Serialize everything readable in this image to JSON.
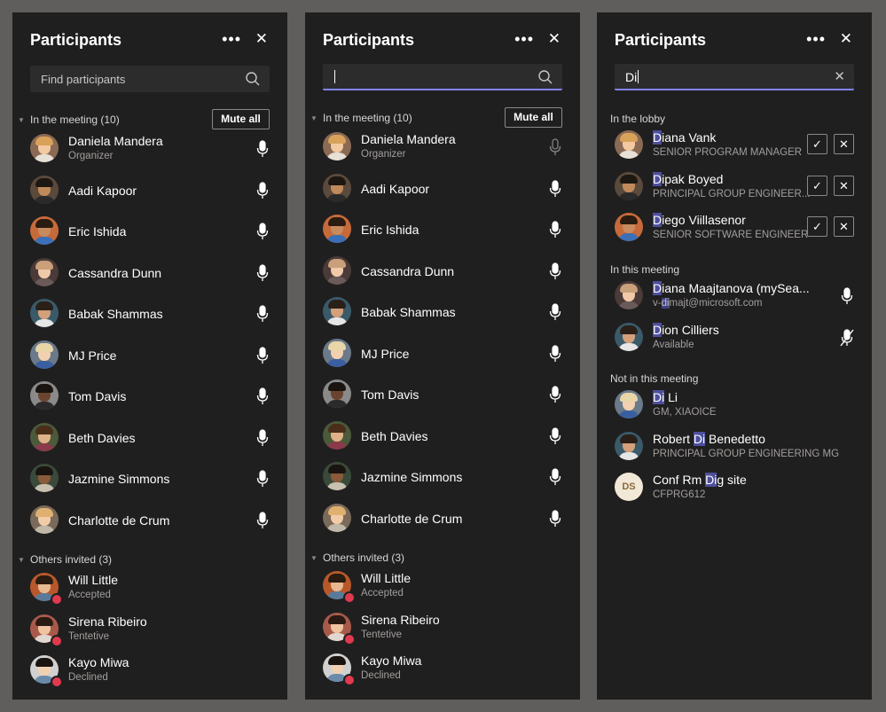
{
  "panels": [
    {
      "title": "Participants",
      "search": {
        "placeholder": "Find participants",
        "value": ""
      },
      "in_meeting_label": "In the meeting (10)",
      "mute_all_label": "Mute all",
      "participants": [
        {
          "name": "Daniela Mandera",
          "subtitle": "Organizer"
        },
        {
          "name": "Aadi Kapoor"
        },
        {
          "name": "Eric Ishida"
        },
        {
          "name": "Cassandra Dunn"
        },
        {
          "name": "Babak Shammas"
        },
        {
          "name": "MJ Price"
        },
        {
          "name": "Tom Davis"
        },
        {
          "name": "Beth Davies"
        },
        {
          "name": "Jazmine Simmons"
        },
        {
          "name": "Charlotte de Crum"
        }
      ],
      "others_label": "Others invited (3)",
      "invited": [
        {
          "name": "Will Little",
          "status": "Accepted"
        },
        {
          "name": "Sirena Ribeiro",
          "status": "Tentetive"
        },
        {
          "name": "Kayo Miwa",
          "status": "Declined"
        }
      ]
    },
    {
      "title": "Participants",
      "search": {
        "placeholder": "",
        "value": ""
      },
      "in_meeting_label": "In the meeting (10)",
      "mute_all_label": "Mute all",
      "participants": [
        {
          "name": "Daniela Mandera",
          "subtitle": "Organizer"
        },
        {
          "name": "Aadi Kapoor"
        },
        {
          "name": "Eric Ishida"
        },
        {
          "name": "Cassandra Dunn"
        },
        {
          "name": "Babak Shammas"
        },
        {
          "name": "MJ Price"
        },
        {
          "name": "Tom Davis"
        },
        {
          "name": "Beth Davies"
        },
        {
          "name": "Jazmine Simmons"
        },
        {
          "name": "Charlotte de Crum"
        }
      ],
      "others_label": "Others invited (3)",
      "invited": [
        {
          "name": "Will Little",
          "status": "Accepted"
        },
        {
          "name": "Sirena Ribeiro",
          "status": "Tentetive"
        },
        {
          "name": "Kayo Miwa",
          "status": "Declined"
        }
      ]
    },
    {
      "title": "Participants",
      "search": {
        "value": "Di"
      },
      "lobby_label": "In the lobby",
      "lobby": [
        {
          "hl": "D",
          "name_rest": "iana Vank",
          "subtitle": "SENIOR PROGRAM MANAGER"
        },
        {
          "hl": "D",
          "name_rest": "ipak Boyed",
          "subtitle": "PRINCIPAL GROUP ENGINEER..."
        },
        {
          "hl": "D",
          "name_rest": "iego Viillasenor",
          "subtitle": "SENIOR SOFTWARE ENGINEER"
        }
      ],
      "in_this_meeting_label": "In this meeting",
      "in_this_meeting": [
        {
          "hl": "D",
          "name_rest": "iana Maajtanova (mySea...",
          "sub_pre": "v-",
          "sub_hl": "di",
          "sub_rest": "majt@microsoft.com"
        },
        {
          "hl": "D",
          "name_rest": "ion Cilliers",
          "subtitle": "Available"
        }
      ],
      "not_in_meeting_label": "Not in this meeting",
      "not_in_meeting": [
        {
          "pre": "",
          "hl": "Di",
          "post": " Li",
          "subtitle": "GM, XIAOICE"
        },
        {
          "pre": "Robert ",
          "hl": "Di",
          "post": " Benedetto",
          "subtitle": "PRINCIPAL GROUP ENGINEERING MG"
        },
        {
          "pre": "Conf Rm ",
          "hl": "Di",
          "post": "g site",
          "subtitle": "CFPRG612",
          "initials": "DS"
        }
      ]
    }
  ],
  "icons": {
    "more": "more-icon",
    "close": "close-icon",
    "search": "search-icon",
    "mic": "microphone-icon",
    "mic_off": "microphone-off-icon",
    "check": "check-icon",
    "presence": "presence-busy-icon"
  },
  "colors": {
    "panel_bg": "#201f1f",
    "accent": "#7f85f5",
    "highlight": "#4d4f9e",
    "presence_busy": "#e03a4f"
  }
}
